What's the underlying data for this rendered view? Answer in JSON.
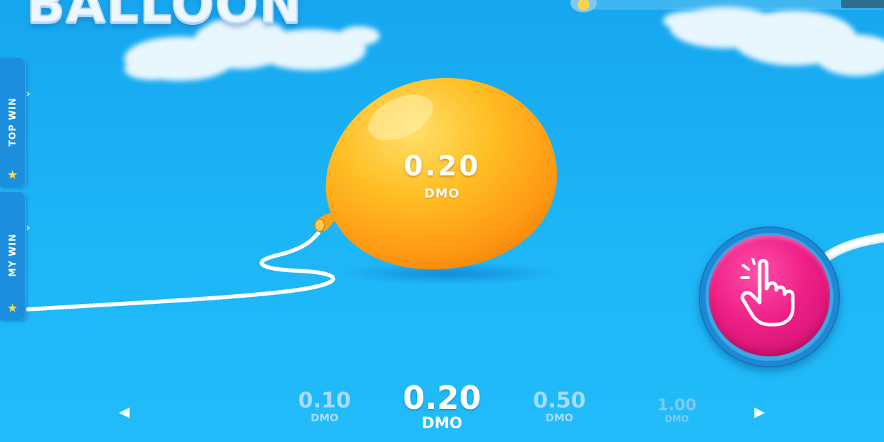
{
  "game": {
    "logo_text": "BALLOON"
  },
  "side_tabs": [
    {
      "label": "TOP WIN",
      "icon": "star-icon"
    },
    {
      "label": "MY WIN",
      "icon": "star-icon"
    }
  ],
  "balloon": {
    "value": "0.20",
    "currency": "DMO",
    "color": "#ffb21c"
  },
  "pump_button": {
    "icon": "hand-pointer-icon",
    "color": "#ee1f87"
  },
  "bet_selector": {
    "left_arrow": "◀",
    "right_arrow": "▶",
    "options": [
      {
        "value": "0.10",
        "currency": "DMO"
      },
      {
        "value": "0.20",
        "currency": "DMO",
        "selected": true
      },
      {
        "value": "0.50",
        "currency": "DMO"
      },
      {
        "value": "1.00",
        "currency": "DMO"
      }
    ]
  },
  "colors": {
    "sky": "#1cb4f6",
    "tab": "#1b8ede",
    "star": "#ffd84a"
  }
}
